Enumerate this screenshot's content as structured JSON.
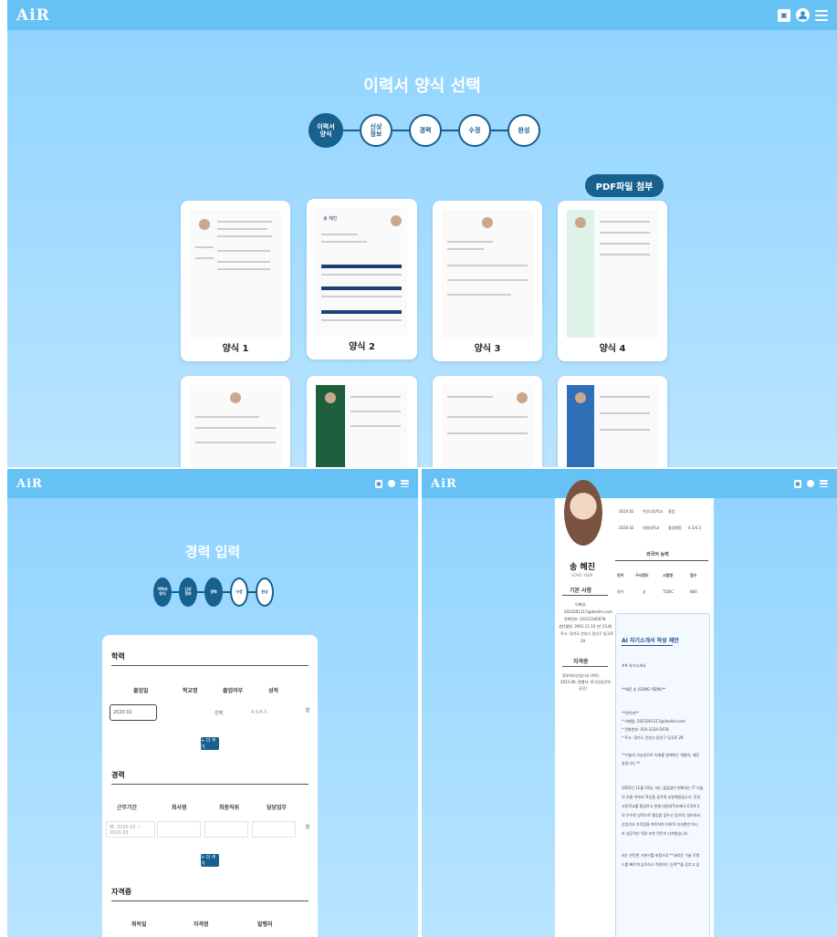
{
  "app": {
    "logo": "AiR",
    "badge_icon": "id-card-icon",
    "user_icon": "user-icon",
    "menu_icon": "menu-icon"
  },
  "top": {
    "title": "이력서 양식 선택",
    "steps": [
      "이력서\n양식",
      "신상\n정보",
      "경력",
      "수정",
      "완성"
    ],
    "pdf_button": "PDF파일 첨부",
    "templates": [
      "양식 1",
      "양식 2",
      "양식 3",
      "양식 4"
    ],
    "template_name_preview": "송 혜진"
  },
  "career": {
    "title": "경력 입력",
    "steps": [
      "이력서\n양식",
      "신상\n정보",
      "경력",
      "수정",
      "완성"
    ],
    "education": {
      "header": "학력",
      "columns": [
        "졸업일",
        "학교명",
        "졸업여부",
        "성적"
      ],
      "row": {
        "date": "2020.02",
        "status": "선택",
        "grade": "4.5/4.5"
      },
      "add": "+ 더 추가"
    },
    "experience": {
      "header": "경력",
      "columns": [
        "근무기간",
        "회사명",
        "최종직위",
        "담당업무"
      ],
      "row": {
        "period": "예: 2020.02 ~ 2020.03"
      },
      "add": "+ 더 추가"
    },
    "certificates": {
      "header": "자격증",
      "columns": [
        "취득일",
        "자격명",
        "발행처"
      ]
    }
  },
  "edit": {
    "name": "송 혜진",
    "name_en": "SONG YEJIN",
    "basic_header": "기본 사항",
    "basic_lines": [
      "이메일:",
      "2023301117@daelim.com",
      "전화번호: 01012345678",
      "생년월일: 2001.11.10 (만 21세)",
      "주소: 경기도 안양시 동안구 임곡로",
      "29"
    ],
    "cert_header": "자격증",
    "cert_lines": [
      "정보처리산업기사 (취득:",
      "2023.06, 발행처: 한국산업인력",
      "공단)"
    ],
    "edu_rows": [
      [
        "2020.02",
        "안양고등학교",
        "졸업"
      ],
      [
        "2026.02",
        "대림대학교",
        "졸업예정",
        "4.5/4.5"
      ]
    ],
    "lang_header": "외국어 능력",
    "lang_columns": [
      "언어",
      "구사정도",
      "시험명",
      "점수"
    ],
    "lang_row": [
      "영어",
      "상",
      "TOEIC",
      "880"
    ],
    "ai_title": "AI 자기소개서 작성 제안",
    "ai_lines": [
      "## 자기소개서",
      "**혜진 송 (SONG YEJIN)**",
      "**연락처**",
      "* 이메일: 2023301117@daelim.com",
      "* 전화번호: 010-1234-5678",
      "* 주소: 경기도 안양시 동안구 임곡로 29",
      "**기술의 가능성으로 미래를 설계하는 개발자, 혜진",
      "송입니다.**",
      "2001년 11월 10일, 저는 끊임없이 변화하는 IT 기술",
      "의 흐름 속에서 혁신을 꿈꾸며 성장해왔습니다. 안양",
      "고등학교를 졸업하고 현재 대림대학교에서 4.5/4.5",
      "의 우수한 성적으로 졸업을 앞두고 있으며, 정보처리",
      "산업기사 자격증을 취득하여 이론적 지식뿐만 아니",
      "라 실무적인 역량 또한 탄탄히 다져왔습니다.",
      "저는 탄탄한 기본기를 바탕으로 **새로운 기술 트렌",
      "드를 빠르게 습득하고 적용하는 능력**을 갖추고 있"
    ]
  }
}
